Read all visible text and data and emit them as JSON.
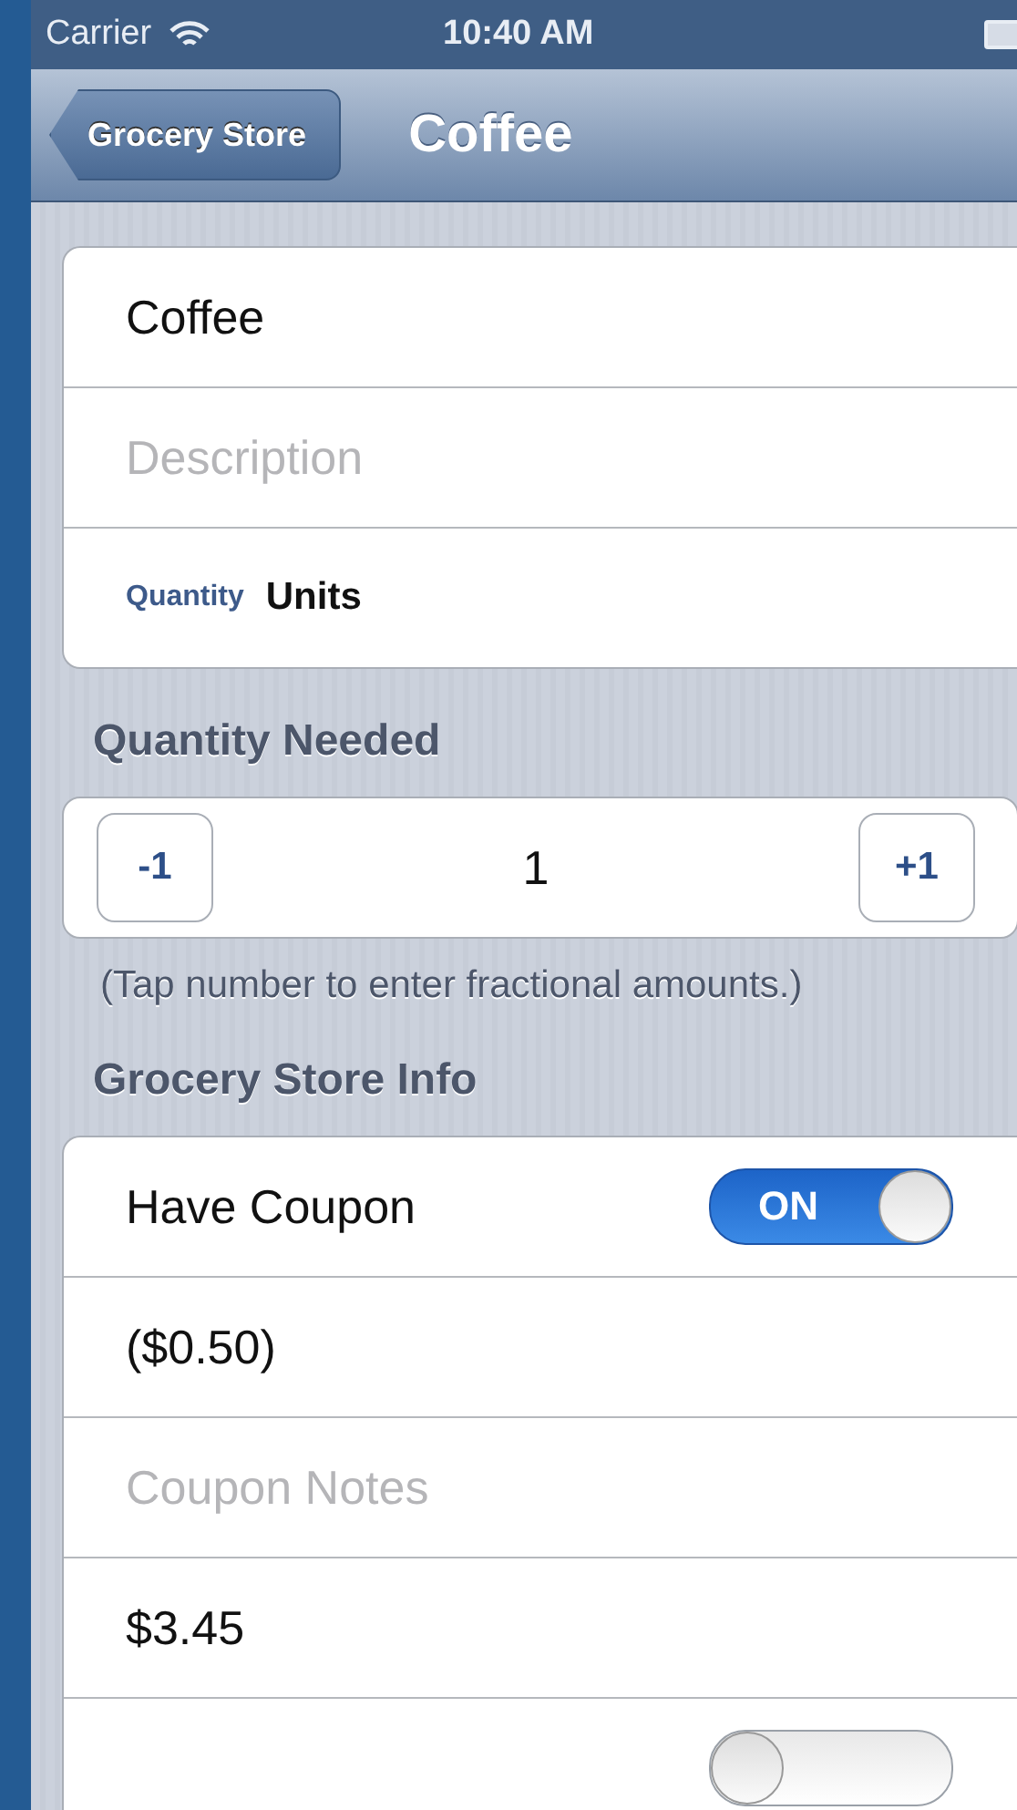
{
  "status_bar": {
    "carrier": "Carrier",
    "time": "10:40 AM"
  },
  "nav": {
    "back": "Grocery Store",
    "title": "Coffee"
  },
  "item_fields": [
    {
      "kind": "value",
      "text": "Coffee"
    },
    {
      "kind": "placeholder",
      "text": "Description"
    },
    {
      "kind": "labeled",
      "label": "Quantity",
      "text": "Units"
    }
  ],
  "quantity": {
    "header": "Quantity Needed",
    "minus": "-1",
    "value": "1",
    "plus": "+1",
    "note": "(Tap number to enter fractional amounts.)"
  },
  "store_info": {
    "header": "Grocery Store Info",
    "rows": [
      {
        "kind": "toggle",
        "label": "Have Coupon",
        "on": true,
        "on_text": "ON"
      },
      {
        "kind": "value",
        "text": "($0.50)"
      },
      {
        "kind": "placeholder",
        "text": "Coupon Notes"
      },
      {
        "kind": "value",
        "text": "$3.45"
      },
      {
        "kind": "toggle",
        "on": false
      }
    ]
  }
}
